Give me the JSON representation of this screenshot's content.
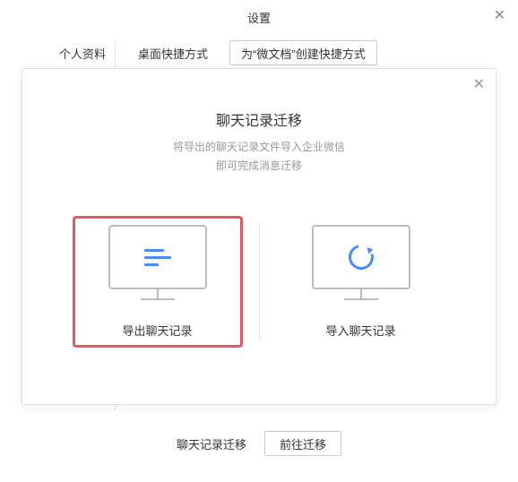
{
  "header": {
    "title": "设置"
  },
  "tabs": {
    "profile": "个人资料",
    "shortcut": "桌面快捷方式",
    "createShortcut": "为“微文档”创建快捷方式"
  },
  "modal": {
    "title": "聊天记录迁移",
    "sub1": "将导出的聊天记录文件导入企业微信",
    "sub2": "即可完成消息迁移",
    "exportLabel": "导出聊天记录",
    "importLabel": "导入聊天记录"
  },
  "bottom": {
    "label": "聊天记录迁移",
    "goto": "前往迁移"
  }
}
